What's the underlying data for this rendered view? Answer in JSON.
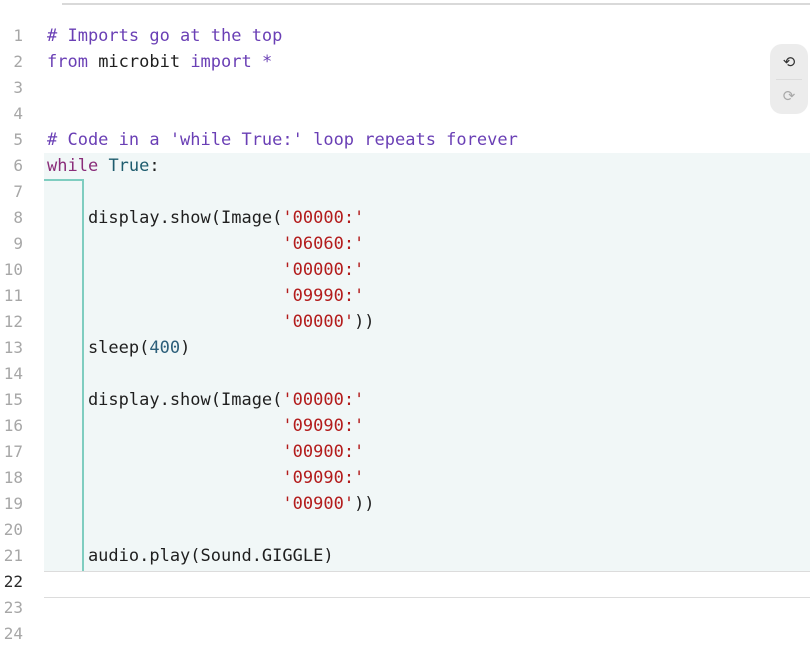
{
  "editor": {
    "line_numbers": [
      "1",
      "2",
      "3",
      "4",
      "5",
      "6",
      "7",
      "8",
      "9",
      "10",
      "11",
      "12",
      "13",
      "14",
      "15",
      "16",
      "17",
      "18",
      "19",
      "20",
      "21",
      "22",
      "23",
      "24"
    ],
    "current_line": "22",
    "code": {
      "l1": "# Imports go at the top",
      "l2_kw1": "from",
      "l2_mod": " microbit ",
      "l2_kw2": "import",
      "l2_star": " *",
      "l5": "# Code in a 'while True:' loop repeats forever",
      "l6_kw": "while",
      "l6_const": "True",
      "l6_colon": ":",
      "l8_pre": "    display.show(Image(",
      "l8_str": "'00000:'",
      "l9_str": "'06060:'",
      "l10_str": "'00000:'",
      "l11_str": "'09990:'",
      "l12_str": "'00000'",
      "l12_post": "))",
      "l13_pre": "    sleep(",
      "l13_num": "400",
      "l13_post": ")",
      "l15_pre": "    display.show(Image(",
      "l15_str": "'00000:'",
      "l16_str": "'09090:'",
      "l17_str": "'00900:'",
      "l18_str": "'09090:'",
      "l19_str": "'00900'",
      "l19_post": "))",
      "l21": "    audio.play(Sound.GIGGLE)",
      "indent": "                       "
    }
  },
  "toolbar": {
    "undo_icon": "undo-icon",
    "redo_icon": "redo-icon",
    "undo_glyph": "⟲",
    "redo_glyph": "⟳"
  },
  "colors": {
    "comment": "#6a3fb5",
    "keyword": "#6a3fb5",
    "string": "#b31c1c",
    "block_highlight": "#f1f7f7",
    "block_rule": "#7fcdc0"
  }
}
